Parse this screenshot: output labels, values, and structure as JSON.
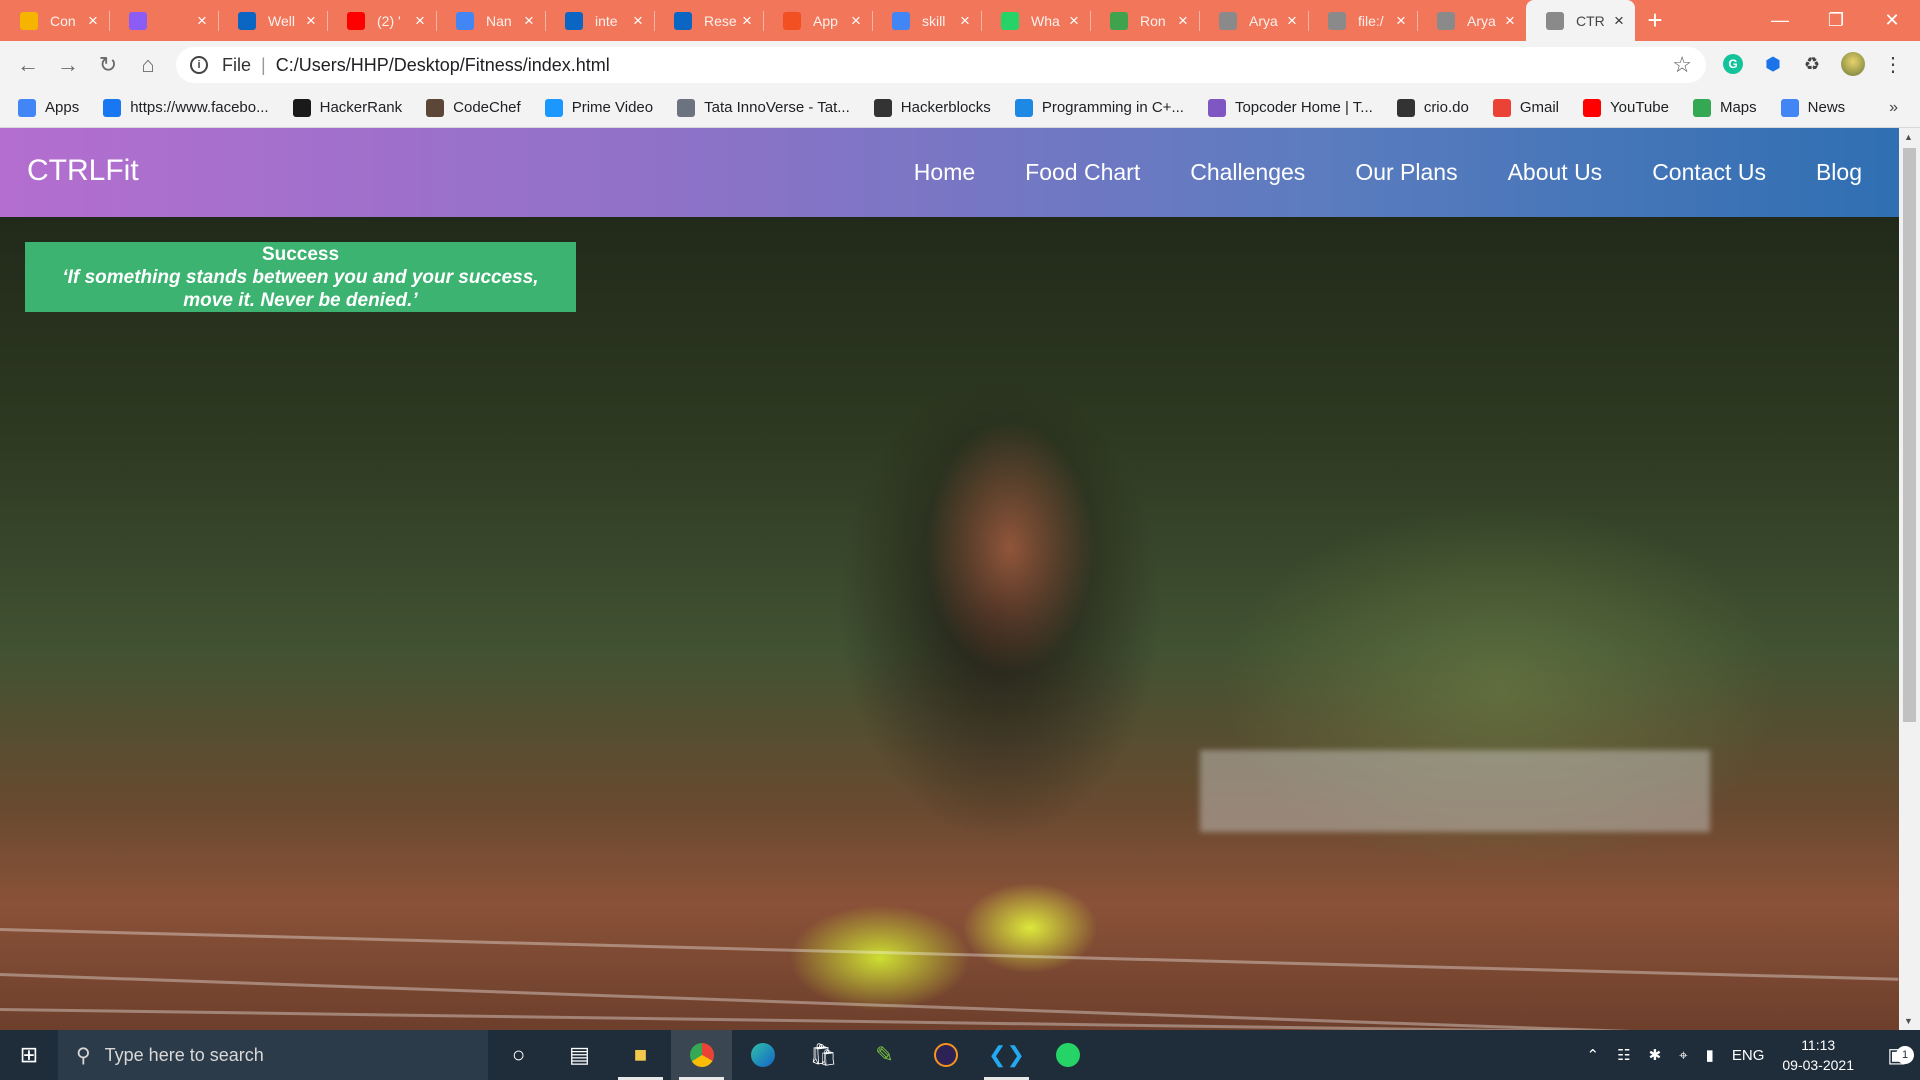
{
  "browser": {
    "tabs": [
      {
        "title": "Con",
        "icon": "notes-icon",
        "color": "#f4b400"
      },
      {
        "title": "",
        "icon": "app-icon",
        "color": "#8b5cf6"
      },
      {
        "title": "Well",
        "icon": "linkedin-icon",
        "color": "#0a66c2"
      },
      {
        "title": "(2) '",
        "icon": "youtube-icon",
        "color": "#ff0000"
      },
      {
        "title": "Nan",
        "icon": "google-icon",
        "color": "#4285f4"
      },
      {
        "title": "inte",
        "icon": "linkedin-icon",
        "color": "#0a66c2"
      },
      {
        "title": "Rese",
        "icon": "linkedin-icon",
        "color": "#0a66c2"
      },
      {
        "title": "App",
        "icon": "microsoft-icon",
        "color": "#f25022"
      },
      {
        "title": "skill",
        "icon": "google-icon",
        "color": "#4285f4"
      },
      {
        "title": "Wha",
        "icon": "whatsapp-icon",
        "color": "#25d366"
      },
      {
        "title": "Ron",
        "icon": "leaf-icon",
        "color": "#3fa34d"
      },
      {
        "title": "Arya",
        "icon": "globe-icon",
        "color": "#8a8a8a"
      },
      {
        "title": "file:/",
        "icon": "globe-icon",
        "color": "#8a8a8a"
      },
      {
        "title": "Arya",
        "icon": "globe-icon",
        "color": "#8a8a8a"
      },
      {
        "title": "CTR",
        "icon": "globe-icon",
        "color": "#8a8a8a",
        "active": true
      }
    ],
    "address": {
      "scheme": "File",
      "url": "C:/Users/HHP/Desktop/Fitness/index.html"
    },
    "bookmarks": [
      {
        "label": "Apps",
        "icon": "apps-grid-icon",
        "color": "#4285f4"
      },
      {
        "label": "https://www.facebo...",
        "icon": "facebook-icon",
        "color": "#1877f2"
      },
      {
        "label": "HackerRank",
        "icon": "hackerrank-icon",
        "color": "#1a1a1a"
      },
      {
        "label": "CodeChef",
        "icon": "codechef-icon",
        "color": "#5b4638"
      },
      {
        "label": "Prime Video",
        "icon": "prime-video-icon",
        "color": "#1a98ff"
      },
      {
        "label": "Tata InnoVerse - Tat...",
        "icon": "tata-icon",
        "color": "#6b7280"
      },
      {
        "label": "Hackerblocks",
        "icon": "hackerblocks-icon",
        "color": "#333333"
      },
      {
        "label": "Programming in C+...",
        "icon": "s-icon",
        "color": "#1e88e5"
      },
      {
        "label": "Topcoder Home | T...",
        "icon": "topcoder-icon",
        "color": "#7e57c2"
      },
      {
        "label": "crio.do",
        "icon": "crio-icon",
        "color": "#333333"
      },
      {
        "label": "Gmail",
        "icon": "gmail-icon",
        "color": "#ea4335"
      },
      {
        "label": "YouTube",
        "icon": "youtube-icon",
        "color": "#ff0000"
      },
      {
        "label": "Maps",
        "icon": "maps-icon",
        "color": "#34a853"
      },
      {
        "label": "News",
        "icon": "news-icon",
        "color": "#4285f4"
      }
    ],
    "more": "»"
  },
  "site": {
    "brand": "CTRLFit",
    "nav": [
      "Home",
      "Food Chart",
      "Challenges",
      "Our Plans",
      "About Us",
      "Contact Us",
      "Blog"
    ],
    "alert": {
      "title": "Success",
      "quote_line1": "‘If something stands between you and your success,",
      "quote_line2": "move it. Never be denied.’",
      "color": "#3cb371"
    }
  },
  "taskbar": {
    "search_placeholder": "Type here to search",
    "language": "ENG",
    "time": "11:13",
    "date": "09-03-2021",
    "notifications": "1"
  }
}
